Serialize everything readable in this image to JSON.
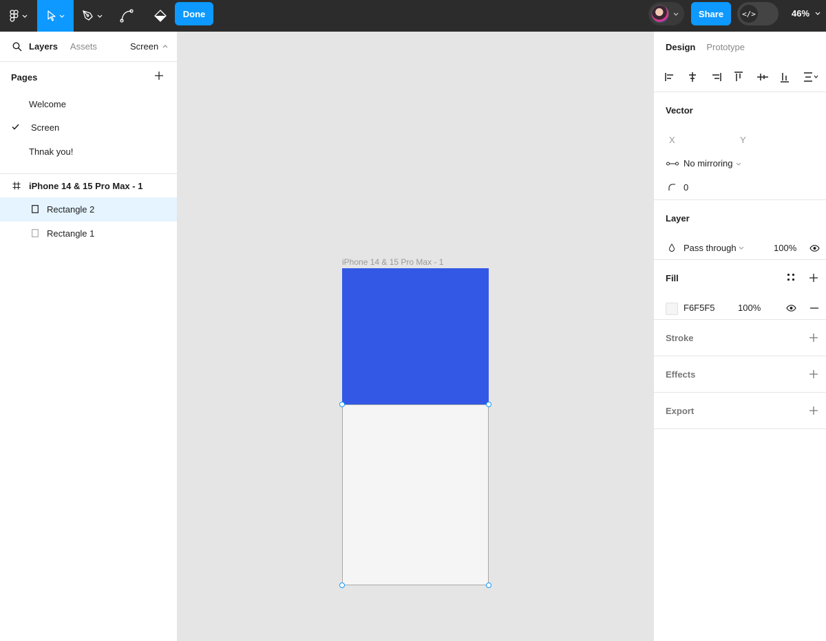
{
  "toolbar": {
    "done_label": "Done",
    "share_label": "Share",
    "devmode_glyph": "</>",
    "zoom_label": "46%",
    "icons": [
      "figma-menu-icon",
      "move-tool-icon",
      "pen-tool-icon",
      "bend-tool-icon",
      "paint-bucket-icon"
    ]
  },
  "left_panel": {
    "tabs": [
      "Layers",
      "Assets"
    ],
    "page_selector": "Screen",
    "pages_title": "Pages",
    "pages": [
      {
        "label": "Welcome",
        "current": false
      },
      {
        "label": "Screen",
        "current": true
      },
      {
        "label": "Thnak you!",
        "current": false
      }
    ],
    "layers": [
      {
        "label": "iPhone 14 & 15 Pro Max - 1",
        "type": "frame"
      },
      {
        "label": "Rectangle 2",
        "type": "rectangle",
        "selected": true
      },
      {
        "label": "Rectangle 1",
        "type": "rectangle",
        "selected": false
      }
    ]
  },
  "canvas": {
    "frame_label": "iPhone 14 & 15 Pro Max - 1",
    "rect2_color": "#3358E5",
    "rect1_color": "#F5F5F5"
  },
  "right_panel": {
    "tabs": [
      "Design",
      "Prototype"
    ],
    "vector": {
      "title": "Vector",
      "x_label": "X",
      "y_label": "Y",
      "mirroring": "No mirroring",
      "corner_radius": "0"
    },
    "layer": {
      "title": "Layer",
      "blend_mode": "Pass through",
      "opacity": "100%"
    },
    "fill": {
      "title": "Fill",
      "hex": "F6F5F5",
      "opacity": "100%"
    },
    "stroke_title": "Stroke",
    "effects_title": "Effects",
    "export_title": "Export"
  }
}
